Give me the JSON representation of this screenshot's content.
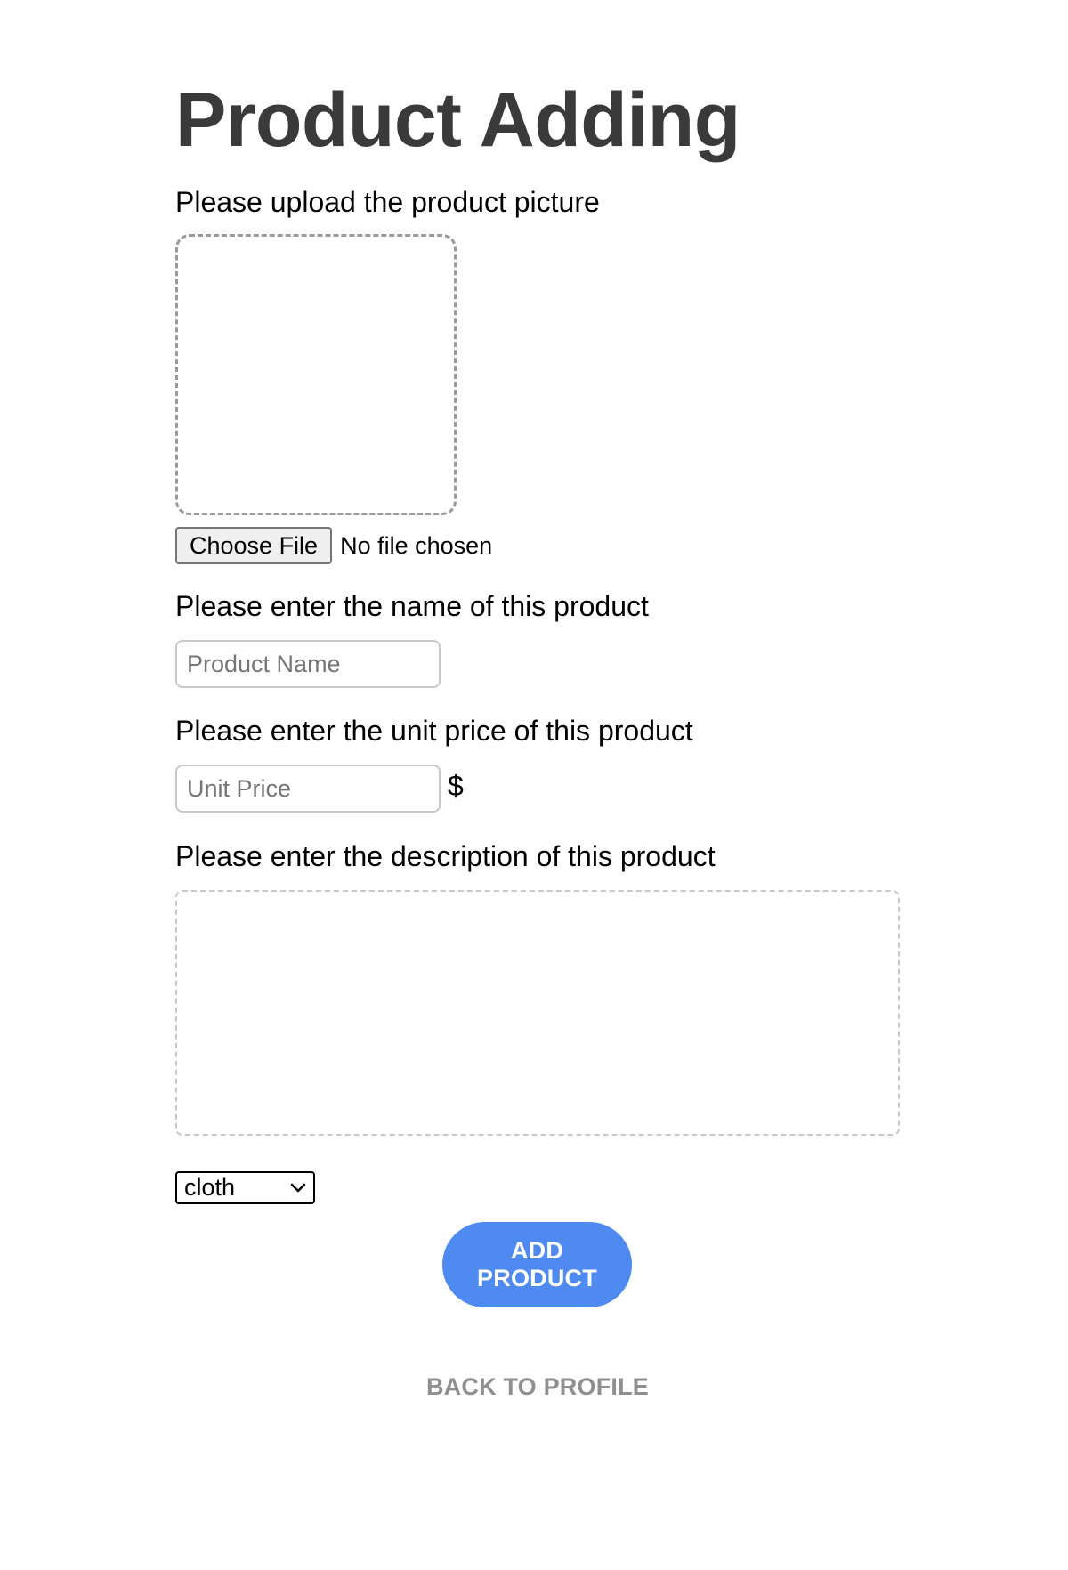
{
  "header": {
    "title": "Product Adding"
  },
  "picture": {
    "label": "Please upload the product picture",
    "choose_file_label": "Choose File",
    "file_status": "No file chosen"
  },
  "name": {
    "label": "Please enter the name of this product",
    "placeholder": "Product Name",
    "value": ""
  },
  "price": {
    "label": "Please enter the unit price of this product",
    "placeholder": "Unit Price",
    "value": "",
    "currency": "$"
  },
  "description": {
    "label": "Please enter the description of this product",
    "value": ""
  },
  "category": {
    "selected": "cloth",
    "icon": "chevron-down-icon"
  },
  "actions": {
    "add_label": "ADD PRODUCT",
    "back_label": "BACK TO PROFILE"
  },
  "colors": {
    "accent": "#4f8af0",
    "title": "#3a3a3a",
    "muted_link": "#8f8f8f"
  }
}
